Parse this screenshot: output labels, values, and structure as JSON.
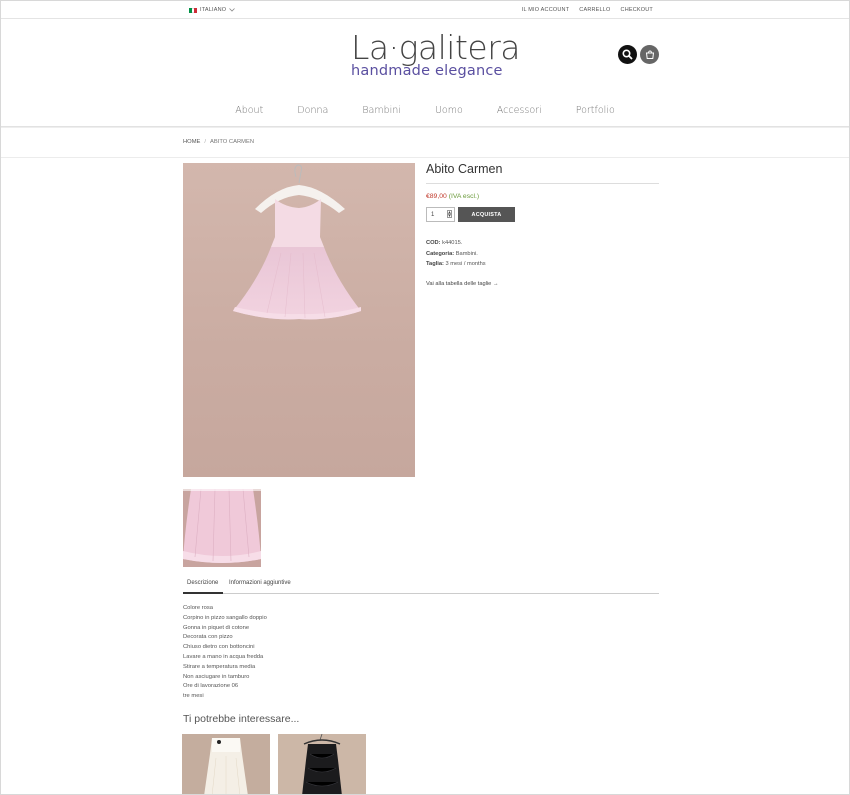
{
  "topbar": {
    "language": "ITALIANO",
    "flag_colors": [
      "#009246",
      "#ffffff",
      "#ce2b37"
    ],
    "links": [
      "IL MIO ACCOUNT",
      "CARRELLO",
      "CHECKOUT"
    ]
  },
  "logo": {
    "main": "La·galitera",
    "sub": "handmade elegance",
    "accent_color": "#5a4fa0"
  },
  "header_icons": [
    "search-icon",
    "cart-icon"
  ],
  "nav": {
    "items": [
      "About",
      "Donna",
      "Bambini",
      "Uomo",
      "Accessori",
      "Portfolio"
    ]
  },
  "breadcrumb": {
    "home": "HOME",
    "separator": "/",
    "current": "ABITO CARMEN"
  },
  "product": {
    "title": "Abito Carmen",
    "price": "€89,00",
    "tax_note": "(IVA escl.)",
    "quantity": "1",
    "buy_label": "ACQUISTA",
    "sku_label": "COD:",
    "sku": "k44015.",
    "category_label": "Categoria:",
    "category": "Bambini.",
    "size_label": "Taglia:",
    "size": "3 mesi / months",
    "size_chart_link": "Vai alla tabella delle taglie →"
  },
  "tabs": {
    "items": [
      "Descrizione",
      "Informazioni aggiuntive"
    ]
  },
  "description": [
    "Colore rosa",
    "Corpino in pizzo sangallo doppio",
    "Gonna in piquet di cotone",
    "Decorata con pizzo",
    "Chiuso dietro con bottoncini",
    "Lavare a mano in acqua fredda",
    "Stirare a temperatura media",
    "Non asciugare in tamburo",
    "Ore di lavorazione 06",
    "tre mesi"
  ],
  "related": {
    "title": "Ti potrebbe interessare..."
  }
}
